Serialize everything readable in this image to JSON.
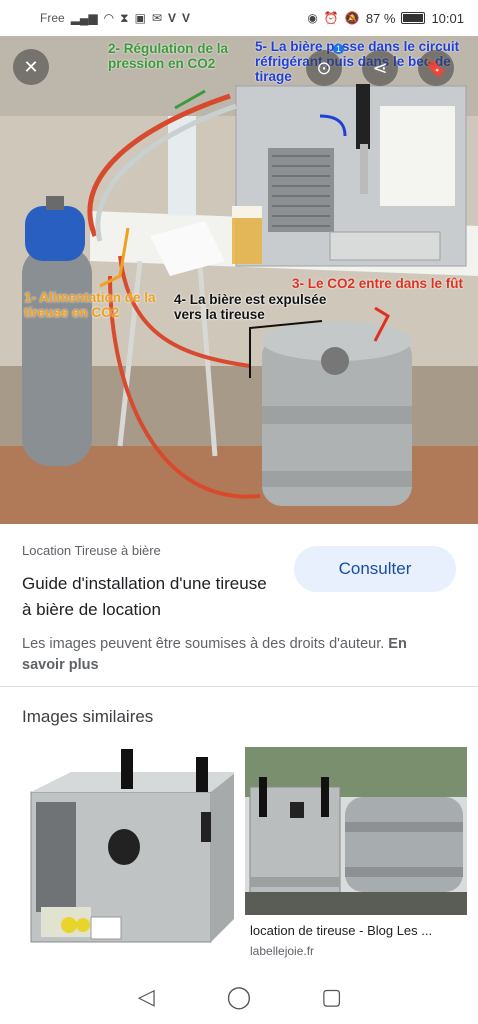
{
  "status_bar": {
    "carrier": "Free",
    "battery_percent": "87 %",
    "battery_level": 0.87,
    "time": "10:01",
    "icons": [
      "signal-icon",
      "wifi-icon",
      "hourglass-icon",
      "notification-icon",
      "mail-icon",
      "v-icon",
      "v-icon",
      "eye-icon",
      "alarm-icon",
      "mute-icon",
      "battery-icon"
    ]
  },
  "hero": {
    "annotations": {
      "regulation": "2- Régulation de la pression en CO2",
      "circuit": "5- La bière passe dans le circuit réfrigérant puis dans le bec de tirage",
      "alimentation": "1- Alimentation de la tireuse en CO2",
      "expulsee": "4- La bière est expulsée vers la tireuse",
      "co2_fut": "3- Le CO2 entre dans le fût"
    },
    "lens_badge": "1",
    "colors": {
      "green": "#3b9a3c",
      "blue": "#1f3fd8",
      "orange": "#f0a020",
      "red": "#e03020"
    }
  },
  "result": {
    "source": "Location Tireuse à bière",
    "title": "Guide d'installation d'une tireuse à bière de location",
    "consult_label": "Consulter",
    "rights_text": "Les images peuvent être soumises à des droits d'auteur.",
    "learn_more": "En savoir plus"
  },
  "similar": {
    "heading": "Images similaires",
    "items": [
      {
        "caption": "",
        "domain": ""
      },
      {
        "caption": "location de tireuse - Blog Les ...",
        "domain": "labellejoie.fr"
      }
    ]
  },
  "accent_color": "#174ea6"
}
